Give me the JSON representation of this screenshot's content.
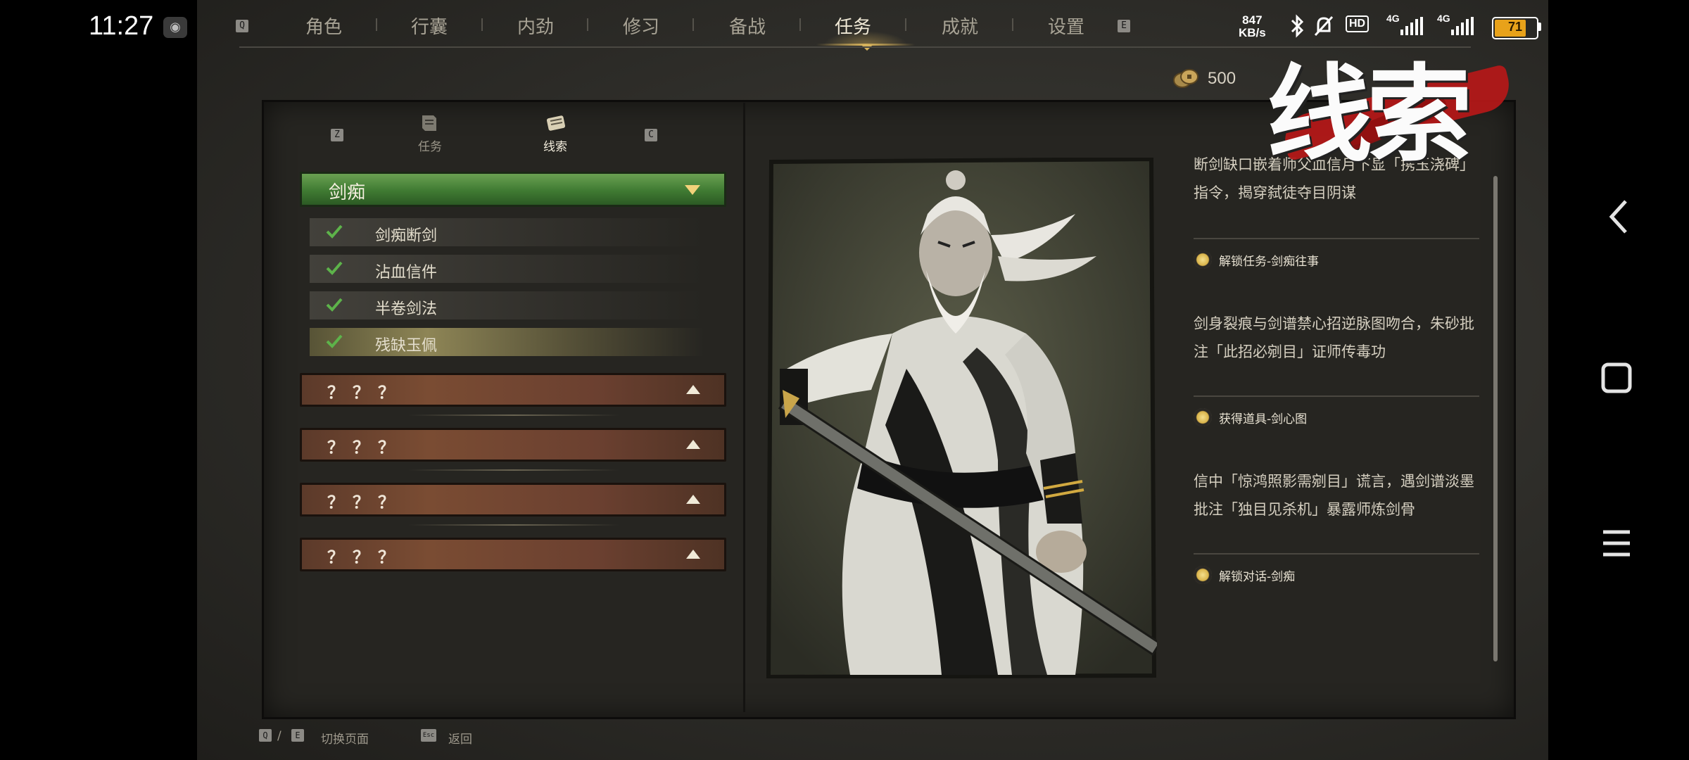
{
  "status_bar": {
    "time": "11:27",
    "net_speed_value": "847",
    "net_speed_unit": "KB/s",
    "hd_label": "HD",
    "network_1": "4G",
    "network_2": "4G",
    "battery_level": "71",
    "battery_fraction": 0.71
  },
  "top_nav": {
    "left_key": "Q",
    "right_key": "E",
    "items": [
      {
        "label": "角色"
      },
      {
        "label": "行囊"
      },
      {
        "label": "内劲"
      },
      {
        "label": "修习"
      },
      {
        "label": "备战"
      },
      {
        "label": "任务"
      },
      {
        "label": "成就"
      },
      {
        "label": "设置"
      }
    ],
    "active_index": 5
  },
  "currency": {
    "value": "500",
    "icon": "coin-icon"
  },
  "overlay_title": "线索",
  "sub_tabs": {
    "left_key": "Z",
    "right_key": "C",
    "items": [
      {
        "label": "任务",
        "icon": "quest-scroll-icon"
      },
      {
        "label": "线索",
        "icon": "clue-scroll-icon"
      }
    ],
    "active_index": 1
  },
  "clue_group": {
    "title": "剑痴",
    "items": [
      {
        "label": "剑痴断剑",
        "done": true
      },
      {
        "label": "沾血信件",
        "done": true
      },
      {
        "label": "半卷剑法",
        "done": true
      },
      {
        "label": "残缺玉佩",
        "done": true
      }
    ],
    "active_index": 3
  },
  "locked_groups": [
    {
      "label": "？？？"
    },
    {
      "label": "？？？"
    },
    {
      "label": "？？？"
    },
    {
      "label": "？？？"
    }
  ],
  "details": {
    "paragraph_1": "断剑缺口嵌着师父血信月下显「携玉浇碑」指令，揭穿弑徒夺目阴谋",
    "reward_1": "解锁任务-剑痴往事",
    "paragraph_2": "剑身裂痕与剑谱禁心招逆脉图吻合，朱砂批注「此招必剜目」证师传毒功",
    "reward_2": "获得道具-剑心图",
    "paragraph_3": "信中「惊鸿照影需剜目」谎言，遇剑谱淡墨批注「独目见杀机」暴露师炼剑骨",
    "reward_3": "解锁对话-剑痴"
  },
  "bottom_hints": {
    "key_q": "Q",
    "slash": "/",
    "key_e": "E",
    "switch_label": "切换页面",
    "key_esc": "Esc",
    "back_label": "返回"
  }
}
